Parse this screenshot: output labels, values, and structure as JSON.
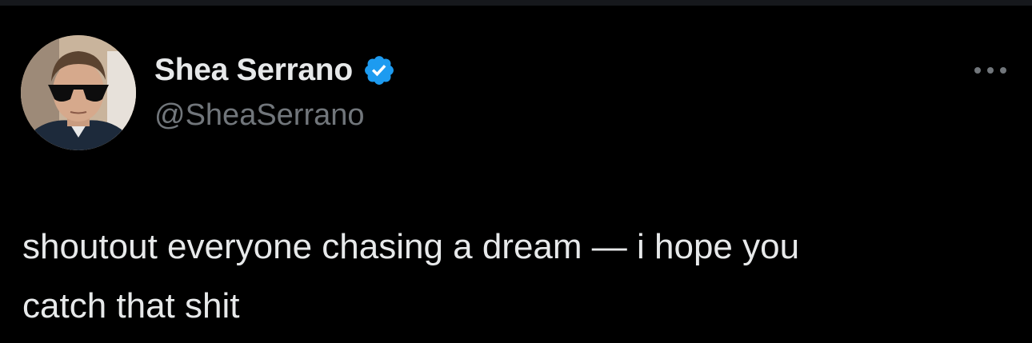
{
  "author": {
    "display_name": "Shea Serrano",
    "handle": "@SheaSerrano",
    "verified": true
  },
  "icons": {
    "verified": "verified-badge-icon",
    "more": "more-options-icon"
  },
  "tweet": {
    "text": "shoutout everyone chasing a dream — i hope you\ncatch that shit"
  },
  "colors": {
    "background": "#000000",
    "text_primary": "#e7e9ea",
    "text_secondary": "#71767b",
    "verified_blue": "#1d9bf0"
  }
}
